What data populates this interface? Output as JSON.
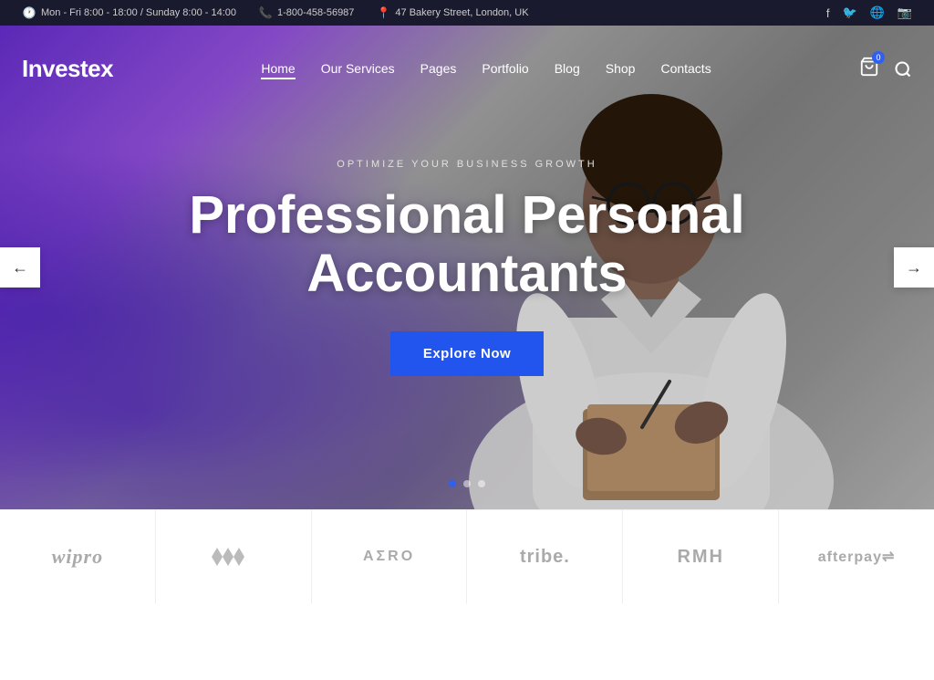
{
  "topbar": {
    "hours": "Mon - Fri 8:00 - 18:00 / Sunday 8:00 - 14:00",
    "phone": "1-800-458-56987",
    "address": "47 Bakery Street, London, UK"
  },
  "logo": {
    "text": "Investex"
  },
  "nav": {
    "items": [
      {
        "label": "Home",
        "active": true
      },
      {
        "label": "Our Services",
        "active": false
      },
      {
        "label": "Pages",
        "active": false
      },
      {
        "label": "Portfolio",
        "active": false
      },
      {
        "label": "Blog",
        "active": false
      },
      {
        "label": "Shop",
        "active": false
      },
      {
        "label": "Contacts",
        "active": false
      }
    ],
    "cart_count": "0"
  },
  "hero": {
    "subtitle": "Optimize Your Business Growth",
    "title": "Professional Personal Accountants",
    "cta": "Explore Now"
  },
  "slider": {
    "dots": [
      {
        "active": true
      },
      {
        "active": false
      },
      {
        "active": false
      }
    ],
    "prev_label": "←",
    "next_label": "→"
  },
  "partners": [
    {
      "name": "wipro",
      "display": "wipro",
      "type": "text"
    },
    {
      "name": "diamonds",
      "display": "◆◆◆",
      "type": "diamond"
    },
    {
      "name": "aero",
      "display": "AΣRO",
      "type": "text"
    },
    {
      "name": "tribe",
      "display": "tribe.",
      "type": "text"
    },
    {
      "name": "rmh",
      "display": "RMH",
      "type": "text"
    },
    {
      "name": "afterpay",
      "display": "afterpay⇌",
      "type": "text"
    }
  ]
}
